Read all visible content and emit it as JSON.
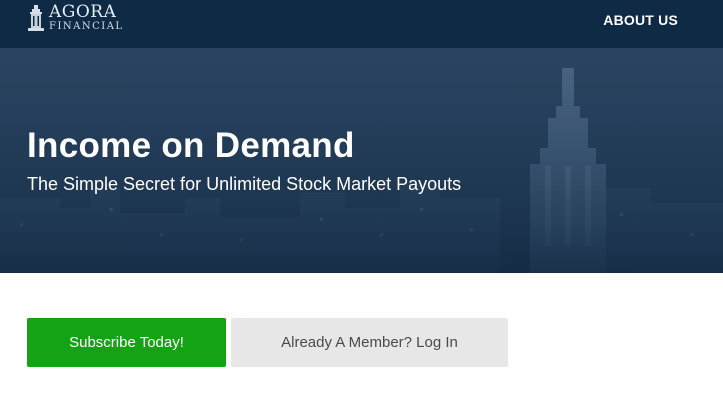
{
  "header": {
    "logo_line1": "AGORA",
    "logo_line2": "FINANCIAL",
    "logo_icon": "monument-logo-icon",
    "about_label": "ABOUT US"
  },
  "hero": {
    "title": "Income on Demand",
    "subtitle": "The Simple Secret for Unlimited Stock Market Payouts"
  },
  "actions": {
    "subscribe_label": "Subscribe Today!",
    "login_label": "Already A Member? Log In"
  },
  "colors": {
    "header_bg": "#0e2a45",
    "hero_bg": "#233d5a",
    "subscribe_bg": "#14a314",
    "login_bg": "#e7e7e7"
  }
}
